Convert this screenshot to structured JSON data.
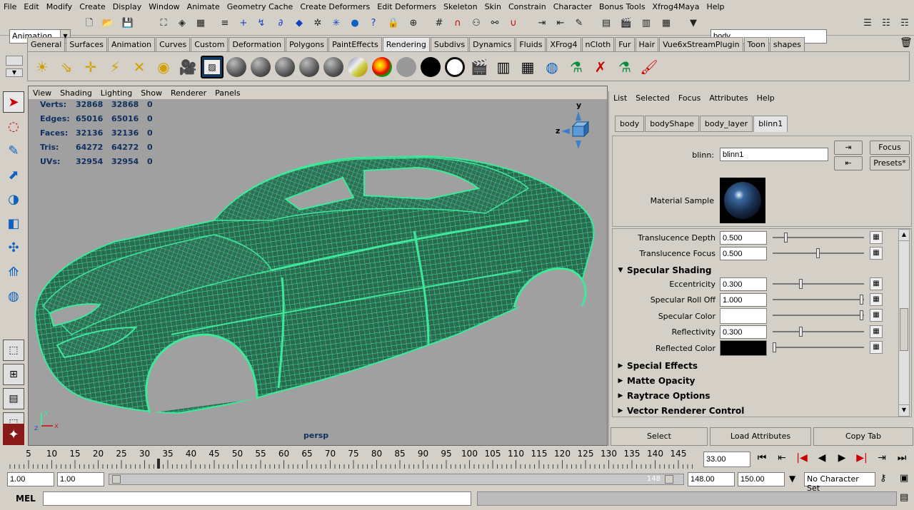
{
  "menu": [
    "File",
    "Edit",
    "Modify",
    "Create",
    "Display",
    "Window",
    "Animate",
    "Geometry Cache",
    "Create Deformers",
    "Edit Deformers",
    "Skeleton",
    "Skin",
    "Constrain",
    "Character",
    "Bonus Tools",
    "Xfrog4Maya",
    "Help"
  ],
  "status": {
    "mode": "Animation",
    "name_field": "body"
  },
  "shelf_tabs": [
    "General",
    "Surfaces",
    "Animation",
    "Curves",
    "Custom",
    "Deformation",
    "Polygons",
    "PaintEffects",
    "Rendering",
    "Subdivs",
    "Dynamics",
    "Fluids",
    "XFrog4",
    "nCloth",
    "Fur",
    "Hair",
    "Vue6xStreamPlugin",
    "Toon",
    "shapes"
  ],
  "shelf_active_tab": "Rendering",
  "viewport": {
    "menu": [
      "View",
      "Shading",
      "Lighting",
      "Show",
      "Renderer",
      "Panels"
    ],
    "camera": "persp",
    "hud": [
      {
        "label": "Verts:",
        "a": "32868",
        "b": "32868",
        "c": "0"
      },
      {
        "label": "Edges:",
        "a": "65016",
        "b": "65016",
        "c": "0"
      },
      {
        "label": "Faces:",
        "a": "32136",
        "b": "32136",
        "c": "0"
      },
      {
        "label": "Tris:",
        "a": "64272",
        "b": "64272",
        "c": "0"
      },
      {
        "label": "UVs:",
        "a": "32954",
        "b": "32954",
        "c": "0"
      }
    ],
    "axis_labels": {
      "y": "y",
      "z": "z",
      "x": "x"
    }
  },
  "attribute_editor": {
    "menu": [
      "List",
      "Selected",
      "Focus",
      "Attributes",
      "Help"
    ],
    "tabs": [
      "body",
      "bodyShape",
      "body_layer",
      "blinn1"
    ],
    "active_tab": "blinn1",
    "node_label": "blinn:",
    "node_name": "blinn1",
    "focus_btn": "Focus",
    "presets_btn": "Presets*",
    "material_sample_label": "Material Sample",
    "translucence_depth": {
      "label": "Translucence Depth",
      "value": "0.500",
      "level": 0.13
    },
    "translucence_focus": {
      "label": "Translucence Focus",
      "value": "0.500",
      "level": 0.5
    },
    "specular_section": "Specular Shading",
    "eccentricity": {
      "label": "Eccentricity",
      "value": "0.300",
      "level": 0.3
    },
    "specular_rolloff": {
      "label": "Specular Roll Off",
      "value": "1.000",
      "level": 1.0
    },
    "specular_color": {
      "label": "Specular Color",
      "level": 1.0
    },
    "reflectivity": {
      "label": "Reflectivity",
      "value": "0.300",
      "level": 0.3
    },
    "reflected_color": {
      "label": "Reflected Color",
      "level": 0.0
    },
    "sections": [
      "Special Effects",
      "Matte Opacity",
      "Raytrace Options",
      "Vector Renderer Control"
    ],
    "buttons": [
      "Select",
      "Load Attributes",
      "Copy Tab"
    ]
  },
  "time_slider": {
    "ticks": [
      "5",
      "10",
      "15",
      "20",
      "25",
      "30",
      "35",
      "40",
      "45",
      "50",
      "55",
      "60",
      "65",
      "70",
      "75",
      "80",
      "85",
      "90",
      "95",
      "100",
      "105",
      "110",
      "115",
      "120",
      "125",
      "130",
      "135",
      "140",
      "145"
    ],
    "current_time": "33.00"
  },
  "range": {
    "start": "1.00",
    "playback_start": "1.00",
    "range_end_label": "148",
    "playback_end": "148.00",
    "end": "150.00",
    "character_set": "No Character Set"
  },
  "command_line": {
    "label": "MEL"
  },
  "colors": {
    "wire": "#3fe89a",
    "viewport_bg": "#a0a0a0",
    "highlight": "#0c3a6a"
  }
}
